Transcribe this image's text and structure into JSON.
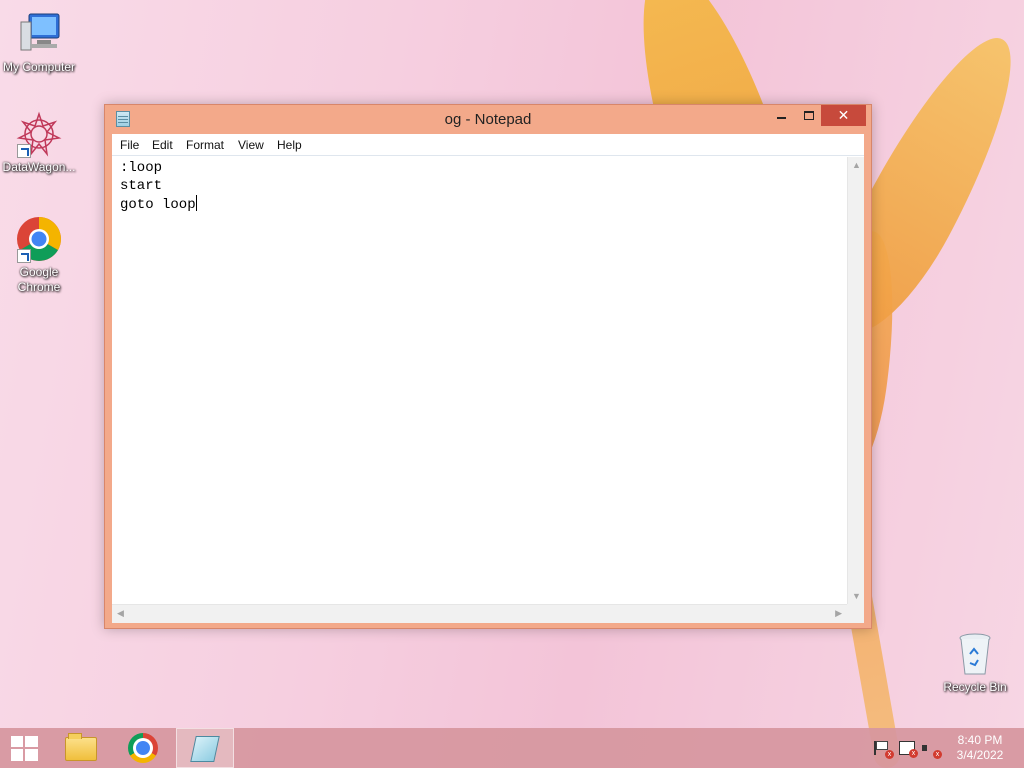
{
  "desktop": {
    "icons": [
      {
        "label": "My Computer",
        "icon": "computer-icon"
      },
      {
        "label": "DataWagon...",
        "icon": "datawagon-icon"
      },
      {
        "label": "Google Chrome",
        "icon": "chrome-icon"
      },
      {
        "label": "Recycle Bin",
        "icon": "recycle-bin-icon"
      }
    ]
  },
  "window": {
    "title": "og - Notepad",
    "close_glyph": "✕",
    "menu": [
      "File",
      "Edit",
      "Format",
      "View",
      "Help"
    ],
    "content_lines": [
      ":loop",
      "start",
      "goto loop"
    ]
  },
  "taskbar": {
    "time": "8:40 PM",
    "date": "3/4/2022",
    "pinned": [
      "start-icon",
      "file-explorer-icon",
      "chrome-icon",
      "notepad-icon"
    ],
    "tray": [
      "action-center-flag-icon",
      "network-icon",
      "volume-muted-icon"
    ]
  },
  "colors": {
    "window_frame": "#f3a98a",
    "close_button": "#c74a3c",
    "taskbar": "#d6969e"
  }
}
